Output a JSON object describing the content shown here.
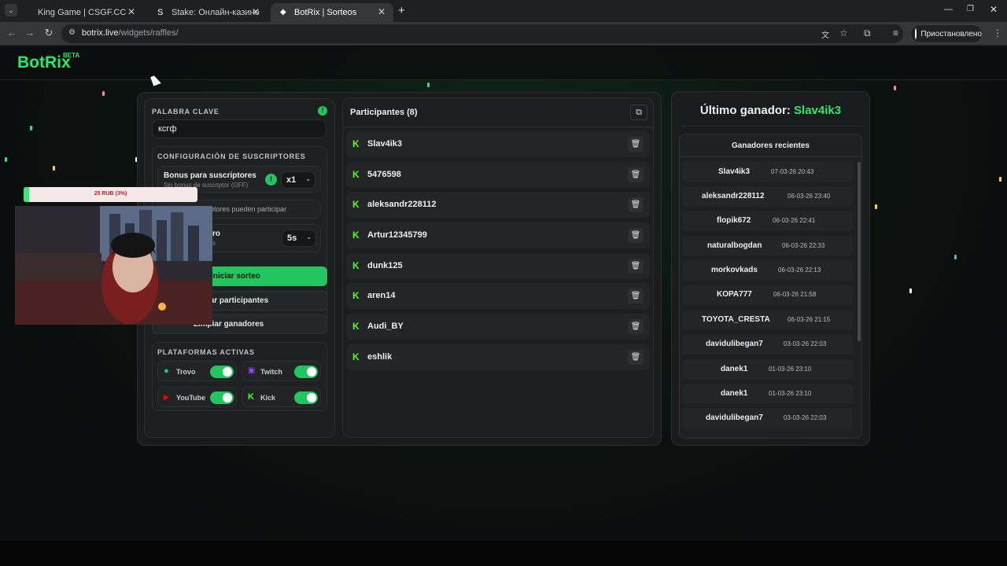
{
  "browser": {
    "tabs": [
      {
        "title": "King Game | CSGF.CC",
        "active": false
      },
      {
        "title": "Stake: Онлайн-казино и ставк…",
        "active": false
      },
      {
        "title": "BotRix | Sorteos",
        "active": true
      }
    ],
    "url_host": "botrix.live",
    "url_path": "/widgets/raffles/",
    "profile_label": "Приостановлено"
  },
  "app": {
    "logo": "BotRix",
    "badge": "BETA"
  },
  "settings": {
    "keyword_label": "PALABRA CLAVE",
    "keyword_value": "ксгф",
    "subscribers_section": "CONFIGURACIÓN DE SUSCRIPTORES",
    "bonus_title": "Bonus para suscriptores",
    "bonus_sub": "Sin bonus de suscriptor (OFF)",
    "bonus_multiplier": "x1",
    "only_subs_text": "otores pueden participar",
    "timer_text": "ro",
    "timer_sub": "s",
    "timer_value": "5s",
    "start_button": "Iniciar sorteo",
    "clear_participants_button": "piar participantes",
    "clear_winners_button": "Limpiar ganadores",
    "platforms_label": "PLATAFORMAS ACTIVAS",
    "platforms": [
      {
        "name": "Trovo",
        "enabled": true,
        "color": "#1aca8a"
      },
      {
        "name": "Twitch",
        "enabled": true,
        "color": "#9146ff"
      },
      {
        "name": "YouTube",
        "enabled": true,
        "color": "#ff0000"
      },
      {
        "name": "Kick",
        "enabled": true,
        "color": "#53fc18"
      }
    ]
  },
  "participants": {
    "title": "Participantes (8)",
    "items": [
      "Slav4ik3",
      "5476598",
      "aleksandr228112",
      "Artur12345799",
      "dunk125",
      "aren14",
      "Audi_BY",
      "eshlik"
    ]
  },
  "winner": {
    "label": "Último ganador:",
    "name": "Slav4ik3",
    "recent_title": "Ganadores recientes",
    "recent": [
      {
        "name": "Slav4ik3",
        "date": "07-03-26 20:43"
      },
      {
        "name": "aleksandr228112",
        "date": "06-03-26 23:40"
      },
      {
        "name": "flopik672",
        "date": "06-03-26 22:41"
      },
      {
        "name": "naturalbogdan",
        "date": "06-03-26 22:33"
      },
      {
        "name": "morkovkads",
        "date": "06-03-26 22:13"
      },
      {
        "name": "KOPA777",
        "date": "06-03-26 21:58"
      },
      {
        "name": "TOYOTA_CRESTA",
        "date": "06-03-26 21:15"
      },
      {
        "name": "davidulibegan7",
        "date": "03-03-26 22:03"
      },
      {
        "name": "danek1",
        "date": "01-03-26 23:10"
      },
      {
        "name": "danek1",
        "date": "01-03-26 23:10"
      },
      {
        "name": "davidulibegan7",
        "date": "03-03-26 22:03"
      }
    ]
  },
  "overlay": {
    "donation_text": "25 RUB (3%)",
    "donation_progress": 0.03
  },
  "colors": {
    "accent": "#2ee86a",
    "kick": "#53fc18"
  }
}
